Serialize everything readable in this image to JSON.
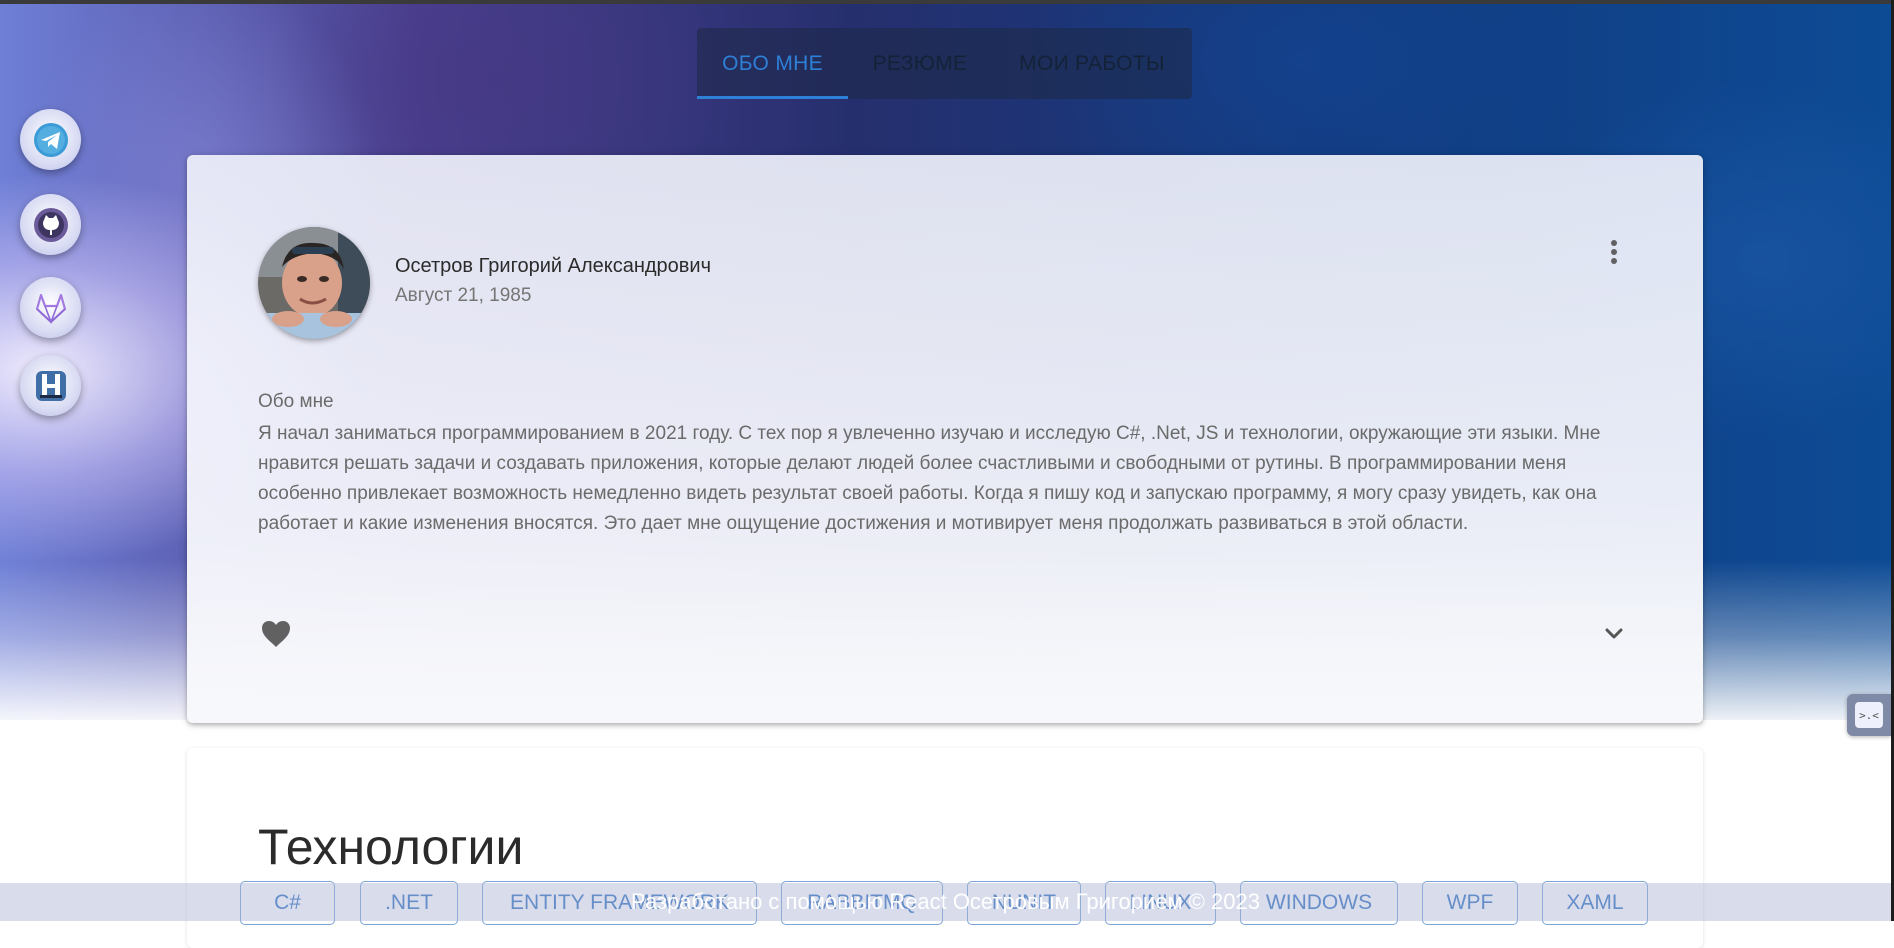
{
  "nav": {
    "tabs": [
      {
        "label": "ОБО МНЕ",
        "active": true
      },
      {
        "label": "РЕЗЮМЕ",
        "active": false
      },
      {
        "label": "МОИ РАБОТЫ",
        "active": false
      }
    ]
  },
  "social": [
    {
      "icon": "telegram-icon"
    },
    {
      "icon": "github-icon"
    },
    {
      "icon": "gitlab-icon"
    },
    {
      "icon": "hh-icon"
    }
  ],
  "profile": {
    "name": "Осетров Григорий Александрович",
    "birthdate": "Август 21, 1985",
    "about_title": "Обо мне",
    "about_text": "Я начал заниматься программированием в 2021 году. С тех пор я увлеченно изучаю и исследую C#, .Net, JS и технологии, окружающие эти языки. Мне нравится решать задачи и создавать приложения, которые делают людей более счастливыми и свободными от рутины. В программировании меня особенно привлекает возможность немедленно видеть результат своей работы. Когда я пишу код и запускаю программу, я могу сразу увидеть, как она работает и какие изменения вносятся. Это дает мне ощущение достижения и мотивирует меня продолжать развиваться в этой области."
  },
  "technologies": {
    "title": "Технологии",
    "items": [
      "C#",
      ".NET",
      "ENTITY FRAMEWORK",
      "RABBITMQ",
      "NUNIT",
      "LINUX",
      "WINDOWS",
      "WPF",
      "XAML"
    ]
  },
  "footer": {
    "text": "Разработано с помощью React Осетровым Григорием © 2023"
  },
  "colors": {
    "accent": "#2e7fd6"
  }
}
